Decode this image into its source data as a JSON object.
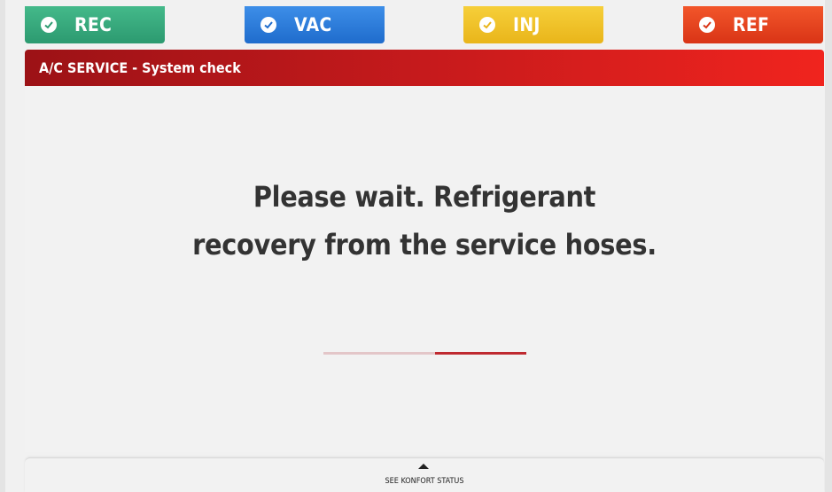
{
  "tabs": [
    {
      "label": "REC",
      "icon": "check-circle-icon",
      "color": "#2c9a70"
    },
    {
      "label": "VAC",
      "icon": "check-circle-icon",
      "color": "#1f6ccc"
    },
    {
      "label": "INJ",
      "icon": "check-circle-icon",
      "color": "#e9b51a"
    },
    {
      "label": "REF",
      "icon": "check-circle-icon",
      "color": "#d93416"
    }
  ],
  "header": {
    "title": "A/C SERVICE - System check"
  },
  "main": {
    "message_line1": "Please wait. Refrigerant",
    "message_line2": "recovery from the service hoses.",
    "progress": {
      "start_fraction": 0.55,
      "end_fraction": 1.0,
      "track_color": "#e3c6c8",
      "fill_color": "#bf2a30"
    }
  },
  "footer": {
    "label": "SEE KONFORT STATUS",
    "icon": "chevron-up-icon"
  }
}
